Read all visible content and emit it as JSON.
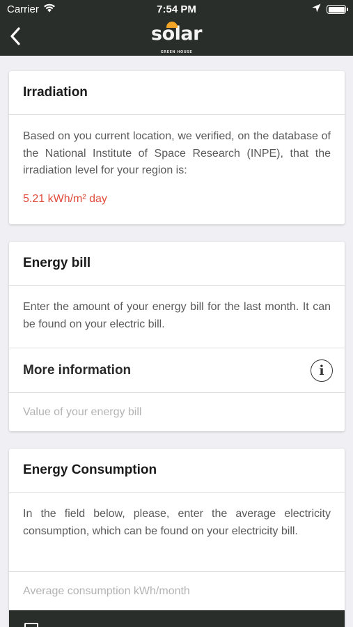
{
  "status_bar": {
    "carrier": "Carrier",
    "time": "7:54 PM"
  },
  "header": {
    "logo_text": "solar",
    "logo_subtitle": "GREEN HOUSE",
    "accent_color": "#f2a524",
    "background_color": "#2a2e2a"
  },
  "irradiation": {
    "title": "Irradiation",
    "description": "Based on you current location, we verified, on the database of the National Institute of Space Research (INPE), that the irradiation level for your region is:",
    "value": "5.21 kWh/m² day",
    "value_color": "#e14b3a"
  },
  "energy_bill": {
    "title": "Energy bill",
    "description": "Enter the amount of your energy bill for the last month. It can be found on your electric bill.",
    "more_info_label": "More information",
    "input_placeholder": "Value of your energy bill",
    "input_value": ""
  },
  "energy_consumption": {
    "title": "Energy Consumption",
    "description": "In the field below, please, enter the average electricity consumption, which can be found on your electricity bill.",
    "input_placeholder": "Average consumption kWh/month",
    "input_value": ""
  },
  "icons": [
    "wifi-icon",
    "location-arrow-icon",
    "battery-icon",
    "back-chevron-icon",
    "info-icon",
    "sun-icon"
  ]
}
